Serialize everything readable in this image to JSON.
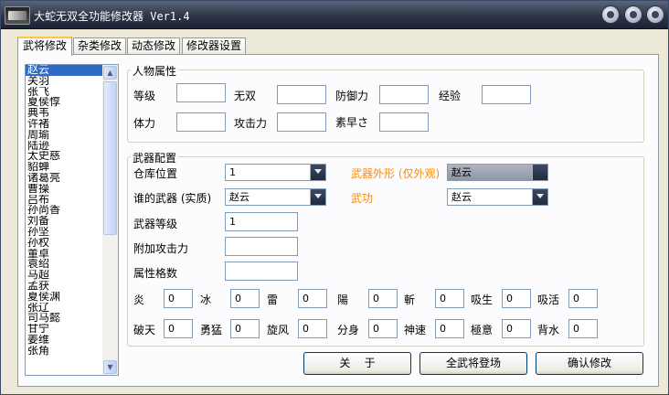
{
  "window": {
    "title": "大蛇无双全功能修改器 Ver1.4"
  },
  "tabs": [
    "武将修改",
    "杂类修改",
    "动态修改",
    "修改器设置"
  ],
  "characters": [
    "赵云",
    "关羽",
    "张飞",
    "夏侯惇",
    "典韦",
    "许褚",
    "周瑜",
    "陆逊",
    "太史慈",
    "貂蝉",
    "诸葛亮",
    "曹操",
    "吕布",
    "孙尚香",
    "刘备",
    "孙坚",
    "孙权",
    "董卓",
    "袁绍",
    "马超",
    "孟获",
    "夏侯渊",
    "张辽",
    "司马懿",
    "甘宁",
    "姜维",
    "张角"
  ],
  "selected_character": "赵云",
  "attributes": {
    "group_title": "人物属性",
    "level": "等级",
    "musou": "无双",
    "defense": "防御力",
    "exp": "经验",
    "hp": "体力",
    "attack": "攻击力",
    "speed": "素早さ",
    "level_value": "",
    "musou_value": "",
    "defense_value": "",
    "exp_value": "",
    "hp_value": "",
    "attack_value": "",
    "speed_value": ""
  },
  "weapon": {
    "group_title": "武器配置",
    "slot_label": "仓库位置",
    "slot_value": "1",
    "owner_label": "谁的武器 (实质)",
    "owner_value": "赵云",
    "appearance_label": "武器外形 (仅外观)",
    "appearance_value": "赵云",
    "skill_label": "武功",
    "skill_value": "赵云",
    "level_label": "武器等级",
    "level_value": "1",
    "bonus_attack_label": "附加攻击力",
    "bonus_attack_value": "",
    "attr_slots_label": "属性格数",
    "attr_slots_value": ""
  },
  "elements_row1": [
    {
      "label": "炎",
      "value": "0"
    },
    {
      "label": "冰",
      "value": "0"
    },
    {
      "label": "雷",
      "value": "0"
    },
    {
      "label": "陽",
      "value": "0"
    },
    {
      "label": "斬",
      "value": "0"
    },
    {
      "label": "吸生",
      "value": "0"
    },
    {
      "label": "吸活",
      "value": "0"
    }
  ],
  "elements_row2": [
    {
      "label": "破天",
      "value": "0"
    },
    {
      "label": "勇猛",
      "value": "0"
    },
    {
      "label": "旋风",
      "value": "0"
    },
    {
      "label": "分身",
      "value": "0"
    },
    {
      "label": "神速",
      "value": "0"
    },
    {
      "label": "極意",
      "value": "0"
    },
    {
      "label": "背水",
      "value": "0"
    }
  ],
  "buttons": {
    "about": "关    于",
    "all_generals": "全武将登场",
    "confirm": "确认修改"
  },
  "colors": {
    "title_bar": "#2e3548",
    "accent_orange": "#ff8a00",
    "selection": "#316ac5"
  }
}
